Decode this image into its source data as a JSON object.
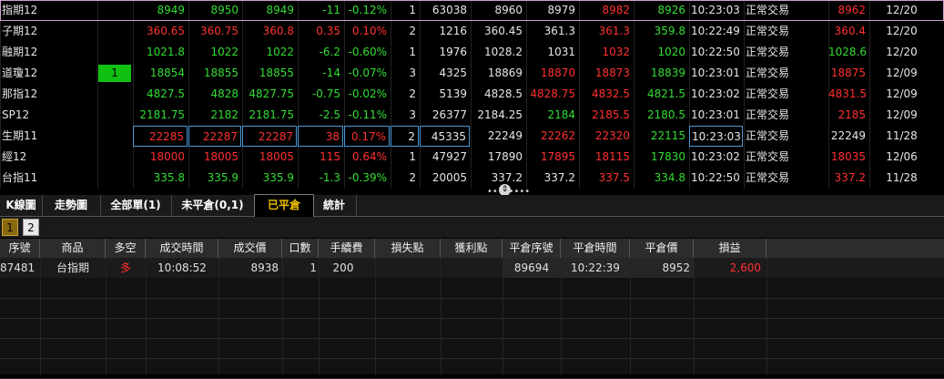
{
  "quotes": [
    {
      "name": "指期12",
      "bid": "",
      "v1": "8949",
      "v2": "8950",
      "v3": "8949",
      "chg": "-11",
      "pct": "-0.12%",
      "n": "1",
      "vol": "63038",
      "open": "8960",
      "high_": "8979",
      "high": "8982",
      "low": "8926",
      "time": "10:23:03",
      "status": "正常交易",
      "ref": "8962",
      "month": "12/20",
      "c": {
        "v1": "dn",
        "v2": "dn",
        "v3": "dn",
        "chg": "dn",
        "pct": "dn",
        "open": "wh",
        "high_": "wh",
        "high": "up",
        "low": "dn",
        "ref": "up"
      }
    },
    {
      "name": "子期12",
      "bid": "",
      "v1": "360.65",
      "v2": "360.75",
      "v3": "360.8",
      "chg": "0.35",
      "pct": "0.10%",
      "n": "2",
      "vol": "1216",
      "open": "360.45",
      "high_": "361.3",
      "high": "361.3",
      "low": "359.8",
      "time": "10:22:49",
      "status": "正常交易",
      "ref": "360.4",
      "month": "12/20",
      "c": {
        "v1": "up",
        "v2": "up",
        "v3": "up",
        "chg": "up",
        "pct": "up",
        "open": "wh",
        "high_": "wh",
        "high": "up",
        "low": "dn",
        "ref": "up"
      }
    },
    {
      "name": "融期12",
      "bid": "",
      "v1": "1021.8",
      "v2": "1022",
      "v3": "1022",
      "chg": "-6.2",
      "pct": "-0.60%",
      "n": "1",
      "vol": "1976",
      "open": "1028.2",
      "high_": "1031",
      "high": "1032",
      "low": "1020",
      "time": "10:22:50",
      "status": "正常交易",
      "ref": "1028.6",
      "month": "12/20",
      "c": {
        "v1": "dn",
        "v2": "dn",
        "v3": "dn",
        "chg": "dn",
        "pct": "dn",
        "open": "wh",
        "high_": "wh",
        "high": "up",
        "low": "dn",
        "ref": "dn"
      }
    },
    {
      "name": "道瓊12",
      "bid": "1",
      "v1": "18854",
      "v2": "18855",
      "v3": "18855",
      "chg": "-14",
      "pct": "-0.07%",
      "n": "3",
      "vol": "4325",
      "open": "18869",
      "high_": "18870",
      "high": "18873",
      "low": "18839",
      "time": "10:23:01",
      "status": "正常交易",
      "ref": "18875",
      "month": "12/09",
      "c": {
        "v1": "dn",
        "v2": "dn",
        "v3": "dn",
        "chg": "dn",
        "pct": "dn",
        "open": "wh",
        "high_": "up",
        "high": "up",
        "low": "dn",
        "ref": "up"
      }
    },
    {
      "name": "那指12",
      "bid": "",
      "v1": "4827.5",
      "v2": "4828",
      "v3": "4827.75",
      "chg": "-0.75",
      "pct": "-0.02%",
      "n": "2",
      "vol": "5139",
      "open": "4828.5",
      "high_": "4828.75",
      "high": "4832.5",
      "low": "4821.5",
      "time": "10:23:02",
      "status": "正常交易",
      "ref": "4831.5",
      "month": "12/09",
      "c": {
        "v1": "dn",
        "v2": "dn",
        "v3": "dn",
        "chg": "dn",
        "pct": "dn",
        "open": "wh",
        "high_": "up",
        "high": "up",
        "low": "dn",
        "ref": "up"
      }
    },
    {
      "name": "SP12",
      "bid": "",
      "v1": "2181.75",
      "v2": "2182",
      "v3": "2181.75",
      "chg": "-2.5",
      "pct": "-0.11%",
      "n": "3",
      "vol": "26377",
      "open": "2184.25",
      "high_": "2184",
      "high": "2185.5",
      "low": "2180.5",
      "time": "10:23:01",
      "status": "正常交易",
      "ref": "2185",
      "month": "12/09",
      "c": {
        "v1": "dn",
        "v2": "dn",
        "v3": "dn",
        "chg": "dn",
        "pct": "dn",
        "open": "wh",
        "high_": "dn",
        "high": "up",
        "low": "dn",
        "ref": "up"
      }
    },
    {
      "name": "生期11",
      "bid": "",
      "v1": "22285",
      "v2": "22287",
      "v3": "22287",
      "chg": "38",
      "pct": "0.17%",
      "n": "2",
      "vol": "45335",
      "open": "22249",
      "high_": "22262",
      "high": "22320",
      "low": "22115",
      "time": "10:23:03",
      "status": "正常交易",
      "ref": "22249",
      "month": "11/28",
      "c": {
        "v1": "up",
        "v2": "up",
        "v3": "up",
        "chg": "up",
        "pct": "up",
        "open": "wh",
        "high_": "up",
        "high": "up",
        "low": "dn",
        "ref": "wh"
      }
    },
    {
      "name": "經12",
      "bid": "",
      "v1": "18000",
      "v2": "18005",
      "v3": "18005",
      "chg": "115",
      "pct": "0.64%",
      "n": "1",
      "vol": "47927",
      "open": "17890",
      "high_": "17895",
      "high": "18115",
      "low": "17830",
      "time": "10:23:02",
      "status": "正常交易",
      "ref": "18035",
      "month": "12/06",
      "c": {
        "v1": "up",
        "v2": "up",
        "v3": "up",
        "chg": "up",
        "pct": "up",
        "open": "wh",
        "high_": "up",
        "high": "up",
        "low": "dn",
        "ref": "up"
      }
    },
    {
      "name": "台指11",
      "bid": "",
      "v1": "335.8",
      "v2": "335.9",
      "v3": "335.9",
      "chg": "-1.3",
      "pct": "-0.39%",
      "n": "2",
      "vol": "20005",
      "open": "337.2",
      "high_": "337.2",
      "high": "337.5",
      "low": "334.8",
      "time": "10:22:50",
      "status": "正常交易",
      "ref": "337.2",
      "month": "11/28",
      "c": {
        "v1": "dn",
        "v2": "dn",
        "v3": "dn",
        "chg": "dn",
        "pct": "dn",
        "open": "wh",
        "high_": "wh",
        "high": "up",
        "low": "dn",
        "ref": "up"
      }
    }
  ],
  "tabs": [
    "K線圖",
    "走勢圖",
    "全部單(1)",
    "未平倉(0,1)",
    "已平倉",
    "統計"
  ],
  "active_tab": "已平倉",
  "pages": [
    "1",
    "2"
  ],
  "grid": {
    "headers": [
      "序號",
      "商品",
      "多空",
      "成交時間",
      "成交價",
      "口數",
      "手續費",
      "損失點",
      "獲利點",
      "平倉序號",
      "平倉時間",
      "平倉價",
      "損益"
    ],
    "row": {
      "seq": "87481",
      "product": "台指期",
      "side": "多",
      "time": "10:08:52",
      "price": "8938",
      "qty": "1",
      "fee": "200",
      "loss": "",
      "profit": "",
      "close_seq": "89694",
      "close_time": "10:22:39",
      "close_price": "8952",
      "pnl": "2,600"
    }
  },
  "colors": {
    "up": "#ff3030",
    "down": "#33dd33",
    "active_tab": "#f0c000",
    "highlight_border": "#4a9ad8"
  }
}
